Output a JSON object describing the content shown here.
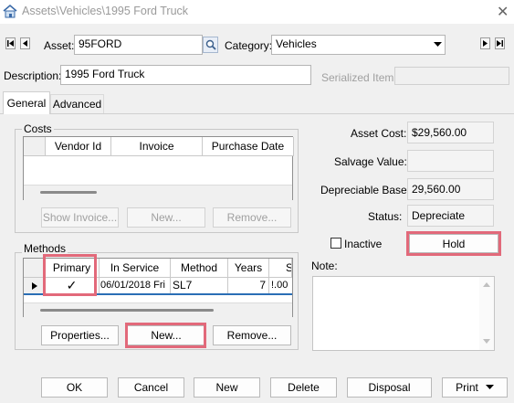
{
  "window": {
    "title": "Assets\\Vehicles\\1995 Ford Truck",
    "close_glyph": "✕"
  },
  "header": {
    "asset_label": "Asset:",
    "asset_value": "95FORD",
    "category_label": "Category:",
    "category_value": "Vehicles",
    "description_label": "Description:",
    "description_value": "1995 Ford Truck",
    "serialized_label": "Serialized Item:"
  },
  "tabs": [
    {
      "label": "General",
      "active": true
    },
    {
      "label": "Advanced",
      "active": false
    }
  ],
  "costs": {
    "group_label": "Costs",
    "columns": [
      "Vendor Id",
      "Invoice",
      "Purchase Date"
    ],
    "buttons": {
      "show_invoice": "Show Invoice...",
      "new": "New...",
      "remove": "Remove..."
    }
  },
  "methods": {
    "group_label": "Methods",
    "columns": [
      "Primary",
      "In Service",
      "Method",
      "Years",
      "S"
    ],
    "rows": [
      {
        "primary": "✓",
        "in_service": "06/01/2018 Fri",
        "method": "SL7",
        "years": "7",
        "s": "!.00"
      }
    ],
    "buttons": {
      "properties": "Properties...",
      "new": "New...",
      "remove": "Remove..."
    }
  },
  "values": {
    "asset_cost_label": "Asset Cost:",
    "asset_cost": "$29,560.00",
    "salvage_label": "Salvage Value:",
    "salvage": "",
    "depreciable_label": "Depreciable Base:",
    "depreciable": "29,560.00",
    "status_label": "Status:",
    "status": "Depreciate",
    "inactive_label": "Inactive",
    "hold_label": "Hold",
    "note_label": "Note:"
  },
  "footer": {
    "ok": "OK",
    "cancel": "Cancel",
    "new": "New",
    "delete": "Delete",
    "disposal": "Disposal",
    "print": "Print"
  },
  "colors": {
    "highlight": "#e2697a",
    "selection_line": "#2a6eb5"
  }
}
